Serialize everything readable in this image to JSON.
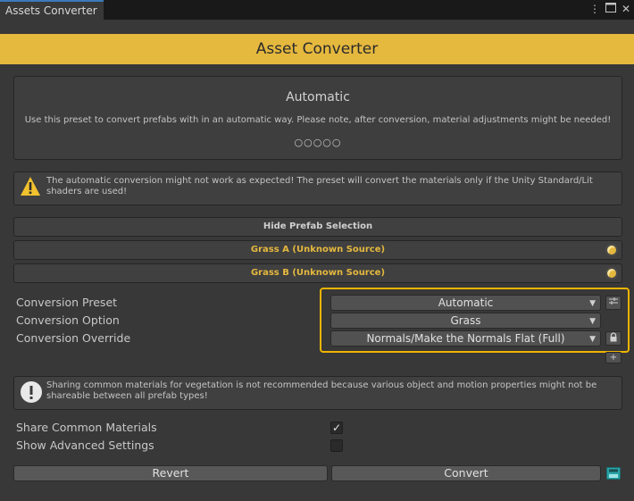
{
  "window": {
    "tab_title": "Assets Converter",
    "menu_icon": "kebab-menu-icon",
    "maximize_icon": "maximize-icon",
    "close_icon": "close-icon"
  },
  "header": {
    "title": "Asset Converter",
    "accent_color": "#e5b83e"
  },
  "preset_panel": {
    "title": "Automatic",
    "description": "Use this preset to convert prefabs with in an automatic way. Please note, after conversion, material adjustments might be needed!",
    "pagination": "○○○○○"
  },
  "warning": {
    "icon": "warning-icon",
    "text": "The automatic conversion might not work as expected! The preset will convert the materials only if the Unity Standard/Lit shaders are used!"
  },
  "prefab_selection": {
    "toggle_label": "Hide Prefab Selection",
    "items": [
      {
        "label": "Grass A (Unknown Source)"
      },
      {
        "label": "Grass B (Unknown Source)"
      }
    ]
  },
  "settings": {
    "conversion_preset": {
      "label": "Conversion Preset",
      "value": "Automatic",
      "side_icon": "settings-sliders-icon"
    },
    "conversion_option": {
      "label": "Conversion Option",
      "value": "Grass"
    },
    "conversion_override": {
      "label": "Conversion Override",
      "value": "Normals/Make the Normals Flat (Full)",
      "side_icon": "lock-icon"
    },
    "add_button": "+"
  },
  "info": {
    "icon": "info-icon",
    "text": "Sharing common materials for vegetation is not recommended because various object and motion properties might not be shareable between all prefab types!"
  },
  "options": {
    "share_common_materials": {
      "label": "Share Common Materials",
      "checked": true
    },
    "show_advanced_settings": {
      "label": "Show Advanced Settings",
      "checked": false
    }
  },
  "actions": {
    "revert_label": "Revert",
    "convert_label": "Convert",
    "extra_icon": "save-icon"
  }
}
